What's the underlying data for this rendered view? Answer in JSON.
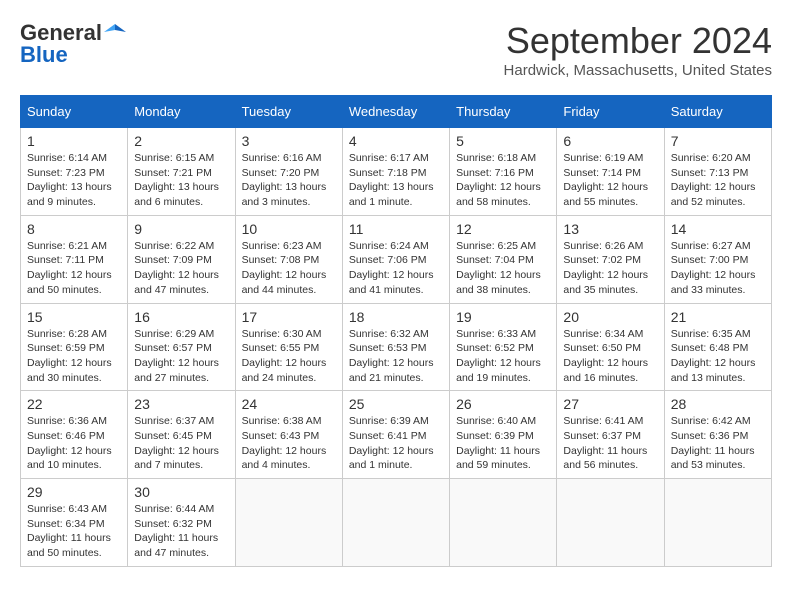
{
  "header": {
    "logo_general": "General",
    "logo_blue": "Blue",
    "month_title": "September 2024",
    "location": "Hardwick, Massachusetts, United States"
  },
  "days_of_week": [
    "Sunday",
    "Monday",
    "Tuesday",
    "Wednesday",
    "Thursday",
    "Friday",
    "Saturday"
  ],
  "weeks": [
    [
      {
        "day": 1,
        "sunrise": "6:14 AM",
        "sunset": "7:23 PM",
        "daylight": "13 hours and 9 minutes."
      },
      {
        "day": 2,
        "sunrise": "6:15 AM",
        "sunset": "7:21 PM",
        "daylight": "13 hours and 6 minutes."
      },
      {
        "day": 3,
        "sunrise": "6:16 AM",
        "sunset": "7:20 PM",
        "daylight": "13 hours and 3 minutes."
      },
      {
        "day": 4,
        "sunrise": "6:17 AM",
        "sunset": "7:18 PM",
        "daylight": "13 hours and 1 minute."
      },
      {
        "day": 5,
        "sunrise": "6:18 AM",
        "sunset": "7:16 PM",
        "daylight": "12 hours and 58 minutes."
      },
      {
        "day": 6,
        "sunrise": "6:19 AM",
        "sunset": "7:14 PM",
        "daylight": "12 hours and 55 minutes."
      },
      {
        "day": 7,
        "sunrise": "6:20 AM",
        "sunset": "7:13 PM",
        "daylight": "12 hours and 52 minutes."
      }
    ],
    [
      {
        "day": 8,
        "sunrise": "6:21 AM",
        "sunset": "7:11 PM",
        "daylight": "12 hours and 50 minutes."
      },
      {
        "day": 9,
        "sunrise": "6:22 AM",
        "sunset": "7:09 PM",
        "daylight": "12 hours and 47 minutes."
      },
      {
        "day": 10,
        "sunrise": "6:23 AM",
        "sunset": "7:08 PM",
        "daylight": "12 hours and 44 minutes."
      },
      {
        "day": 11,
        "sunrise": "6:24 AM",
        "sunset": "7:06 PM",
        "daylight": "12 hours and 41 minutes."
      },
      {
        "day": 12,
        "sunrise": "6:25 AM",
        "sunset": "7:04 PM",
        "daylight": "12 hours and 38 minutes."
      },
      {
        "day": 13,
        "sunrise": "6:26 AM",
        "sunset": "7:02 PM",
        "daylight": "12 hours and 35 minutes."
      },
      {
        "day": 14,
        "sunrise": "6:27 AM",
        "sunset": "7:00 PM",
        "daylight": "12 hours and 33 minutes."
      }
    ],
    [
      {
        "day": 15,
        "sunrise": "6:28 AM",
        "sunset": "6:59 PM",
        "daylight": "12 hours and 30 minutes."
      },
      {
        "day": 16,
        "sunrise": "6:29 AM",
        "sunset": "6:57 PM",
        "daylight": "12 hours and 27 minutes."
      },
      {
        "day": 17,
        "sunrise": "6:30 AM",
        "sunset": "6:55 PM",
        "daylight": "12 hours and 24 minutes."
      },
      {
        "day": 18,
        "sunrise": "6:32 AM",
        "sunset": "6:53 PM",
        "daylight": "12 hours and 21 minutes."
      },
      {
        "day": 19,
        "sunrise": "6:33 AM",
        "sunset": "6:52 PM",
        "daylight": "12 hours and 19 minutes."
      },
      {
        "day": 20,
        "sunrise": "6:34 AM",
        "sunset": "6:50 PM",
        "daylight": "12 hours and 16 minutes."
      },
      {
        "day": 21,
        "sunrise": "6:35 AM",
        "sunset": "6:48 PM",
        "daylight": "12 hours and 13 minutes."
      }
    ],
    [
      {
        "day": 22,
        "sunrise": "6:36 AM",
        "sunset": "6:46 PM",
        "daylight": "12 hours and 10 minutes."
      },
      {
        "day": 23,
        "sunrise": "6:37 AM",
        "sunset": "6:45 PM",
        "daylight": "12 hours and 7 minutes."
      },
      {
        "day": 24,
        "sunrise": "6:38 AM",
        "sunset": "6:43 PM",
        "daylight": "12 hours and 4 minutes."
      },
      {
        "day": 25,
        "sunrise": "6:39 AM",
        "sunset": "6:41 PM",
        "daylight": "12 hours and 1 minute."
      },
      {
        "day": 26,
        "sunrise": "6:40 AM",
        "sunset": "6:39 PM",
        "daylight": "11 hours and 59 minutes."
      },
      {
        "day": 27,
        "sunrise": "6:41 AM",
        "sunset": "6:37 PM",
        "daylight": "11 hours and 56 minutes."
      },
      {
        "day": 28,
        "sunrise": "6:42 AM",
        "sunset": "6:36 PM",
        "daylight": "11 hours and 53 minutes."
      }
    ],
    [
      {
        "day": 29,
        "sunrise": "6:43 AM",
        "sunset": "6:34 PM",
        "daylight": "11 hours and 50 minutes."
      },
      {
        "day": 30,
        "sunrise": "6:44 AM",
        "sunset": "6:32 PM",
        "daylight": "11 hours and 47 minutes."
      },
      null,
      null,
      null,
      null,
      null
    ]
  ]
}
